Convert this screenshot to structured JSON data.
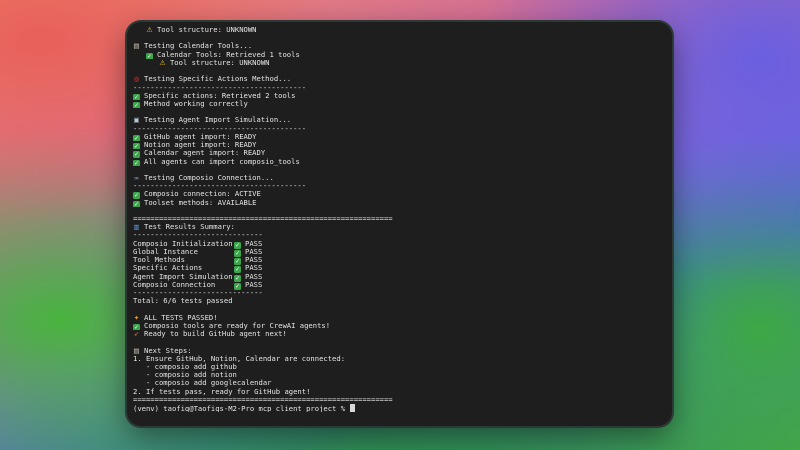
{
  "terminal": {
    "lines": [
      {
        "indent": "   ",
        "icon": "warn",
        "text": "Tool structure: UNKNOWN"
      },
      {
        "text": ""
      },
      {
        "icon": "clip",
        "text": "Testing Calendar Tools..."
      },
      {
        "indent": "   ",
        "icon": "ok",
        "text": "Calendar Tools: Retrieved 1 tools"
      },
      {
        "indent": "      ",
        "icon": "warn",
        "text": "Tool structure: UNKNOWN"
      },
      {
        "text": ""
      },
      {
        "icon": "target",
        "text": "Testing Specific Actions Method..."
      },
      {
        "text": "----------------------------------------"
      },
      {
        "icon": "ok",
        "text": "Specific actions: Retrieved 2 tools"
      },
      {
        "icon": "ok",
        "text": "Method working correctly"
      },
      {
        "text": ""
      },
      {
        "icon": "robot",
        "text": "Testing Agent Import Simulation..."
      },
      {
        "text": "----------------------------------------"
      },
      {
        "icon": "ok",
        "text": "GitHub agent import: READY"
      },
      {
        "icon": "ok",
        "text": "Notion agent import: READY"
      },
      {
        "icon": "ok",
        "text": "Calendar agent import: READY"
      },
      {
        "icon": "ok",
        "text": "All agents can import composio_tools"
      },
      {
        "text": ""
      },
      {
        "icon": "link",
        "text": "Testing Composio Connection..."
      },
      {
        "text": "----------------------------------------"
      },
      {
        "icon": "ok",
        "text": "Composio connection: ACTIVE"
      },
      {
        "icon": "ok",
        "text": "Toolset methods: AVAILABLE"
      },
      {
        "text": ""
      },
      {
        "text": "============================================================"
      },
      {
        "icon": "chart",
        "text": "Test Results Summary:"
      },
      {
        "text": "------------------------------"
      },
      {
        "row": true,
        "label": "Composio Initialization",
        "icon": "ok",
        "text": "PASS"
      },
      {
        "row": true,
        "label": "Global Instance",
        "icon": "ok",
        "text": "PASS"
      },
      {
        "row": true,
        "label": "Tool Methods",
        "icon": "ok",
        "text": "PASS"
      },
      {
        "row": true,
        "label": "Specific Actions",
        "icon": "ok",
        "text": "PASS"
      },
      {
        "row": true,
        "label": "Agent Import Simulation",
        "icon": "ok",
        "text": "PASS"
      },
      {
        "row": true,
        "label": "Composio Connection",
        "icon": "ok",
        "text": "PASS"
      },
      {
        "text": "------------------------------"
      },
      {
        "text": "Total: 6/6 tests passed"
      },
      {
        "text": ""
      },
      {
        "icon": "party",
        "text": "ALL TESTS PASSED!"
      },
      {
        "icon": "ok",
        "text": "Composio tools are ready for CrewAI agents!"
      },
      {
        "icon": "rocket",
        "text": "Ready to build GitHub agent next!"
      },
      {
        "text": ""
      },
      {
        "icon": "clip",
        "text": "Next Steps:"
      },
      {
        "text": "1. Ensure GitHub, Notion, Calendar are connected:"
      },
      {
        "text": "   - composio add github"
      },
      {
        "text": "   - composio add notion"
      },
      {
        "text": "   - composio add googlecalendar"
      },
      {
        "text": "2. If tests pass, ready for GitHub agent!"
      },
      {
        "text": "============================================================"
      },
      {
        "prompt": true,
        "text": "(venv) taofiq@Taofiqs-M2-Pro mcp_client_project % "
      }
    ]
  },
  "icons": {
    "ok": "✓",
    "warn": "⚠",
    "clip": "▤",
    "target": "◎",
    "robot": "▣",
    "link": "∞",
    "chart": "▥",
    "party": "✦",
    "rocket": "➶"
  },
  "icon_names": {
    "ok": "check-icon",
    "warn": "warning-icon",
    "clip": "clipboard-icon",
    "target": "target-icon",
    "robot": "robot-icon",
    "link": "link-icon",
    "chart": "chart-icon",
    "party": "party-icon",
    "rocket": "rocket-icon"
  }
}
